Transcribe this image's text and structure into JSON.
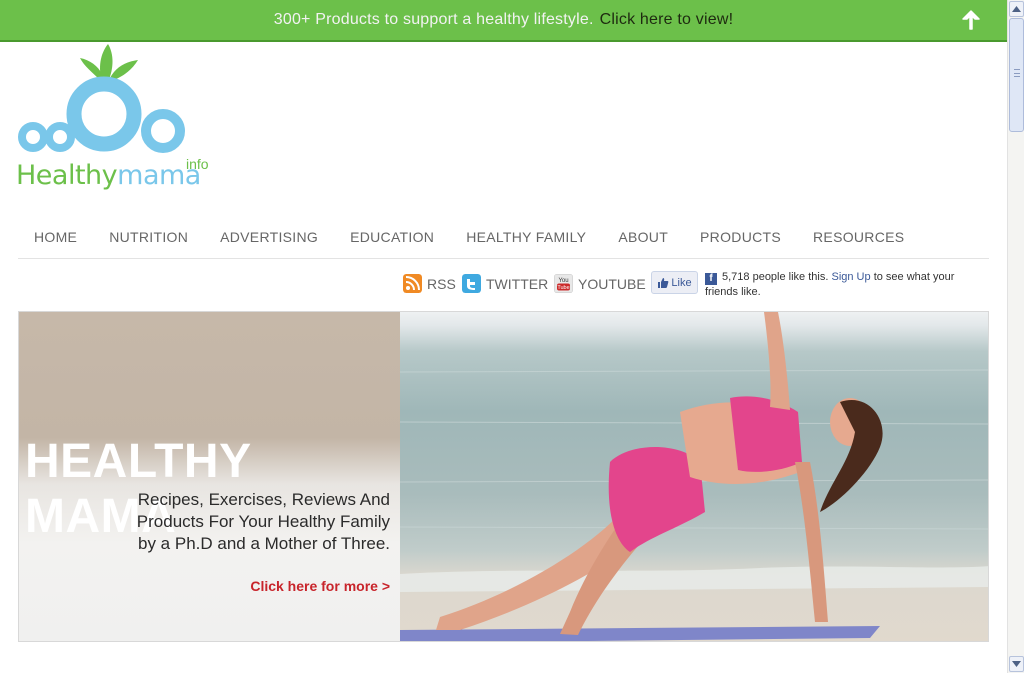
{
  "promo": {
    "message": "300+ Products to support a healthy lifestyle.",
    "link": "Click here to view!"
  },
  "logo": {
    "word1": "Healthy",
    "word2": "mama",
    "suffix": "info"
  },
  "nav": {
    "items": [
      "HOME",
      "NUTRITION",
      "ADVERTISING",
      "EDUCATION",
      "HEALTHY FAMILY",
      "ABOUT",
      "PRODUCTS",
      "RESOURCES"
    ]
  },
  "social": {
    "rss": "RSS",
    "twitter": "TWITTER",
    "youtube": "YOUTUBE",
    "like_button": "Like",
    "fb_count_text": "5,718 people like this.",
    "fb_signup": "Sign Up",
    "fb_suffix": "to see what your friends like."
  },
  "hero": {
    "title": "HEALTHY MAMA",
    "tagline_lines": [
      "Recipes, Exercises, Reviews And",
      "Products For Your Healthy Family",
      "by a Ph.D and a Mother of Three."
    ],
    "cta": "Click here for more >"
  },
  "colors": {
    "brand_green": "#6cc04a",
    "brand_blue": "#7ac7ea",
    "cta_red": "#c8242b",
    "facebook_blue": "#3b5998"
  },
  "icons": [
    "arrow-up-icon",
    "rss-icon",
    "twitter-icon",
    "youtube-icon",
    "thumbs-up-icon",
    "facebook-icon",
    "scroll-up-icon",
    "scroll-down-icon"
  ]
}
